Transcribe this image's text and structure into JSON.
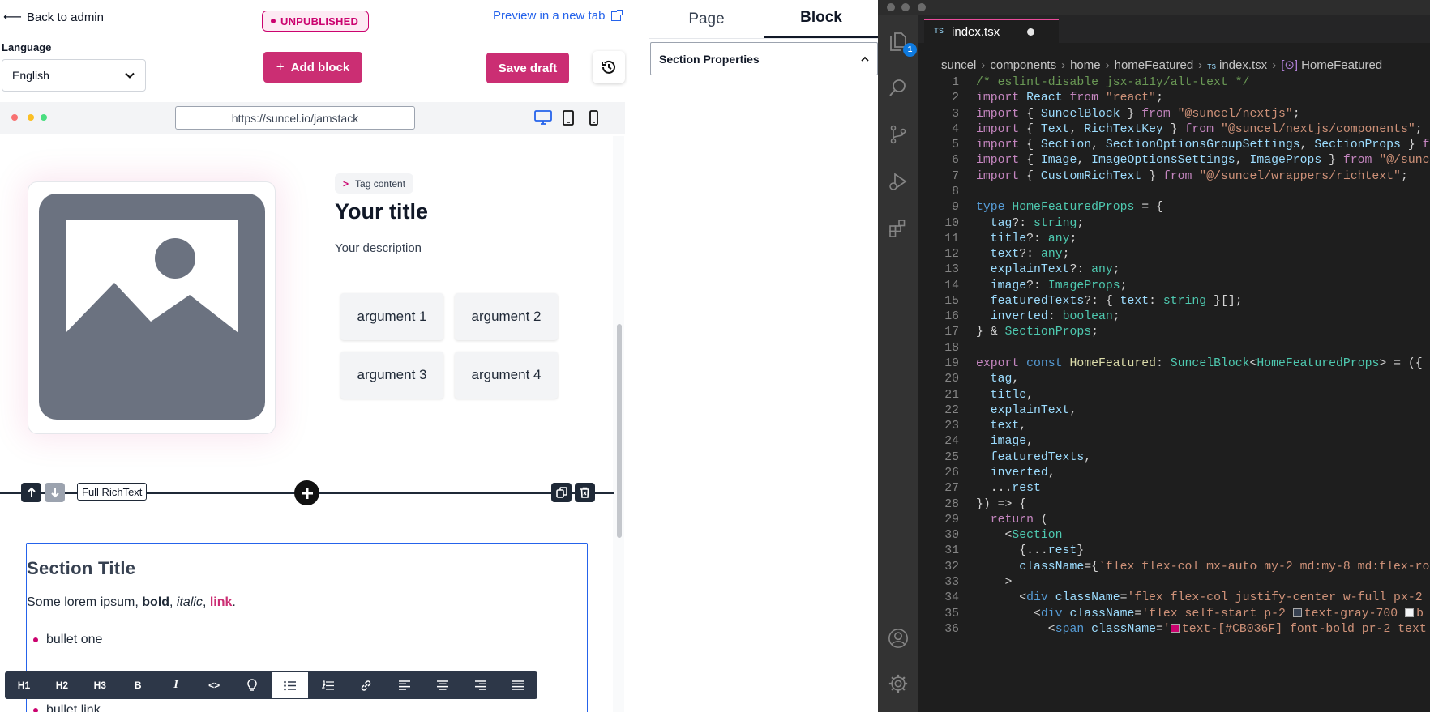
{
  "editor": {
    "back_label": "Back to admin",
    "status_badge": "UNPUBLISHED",
    "preview_label": "Preview in a new tab",
    "language_label": "Language",
    "language_value": "English",
    "add_block_label": "Add block",
    "save_draft_label": "Save draft",
    "url": "https://suncel.io/jamstack",
    "accent_color": "#cb2e73"
  },
  "featured": {
    "tag": "Tag content",
    "title": "Your title",
    "description": "Your description",
    "arguments": [
      "argument 1",
      "argument 2",
      "argument 3",
      "argument 4"
    ]
  },
  "block_bar": {
    "label": "Full RichText"
  },
  "richtext": {
    "title": "Section Title",
    "lorem_prefix": "Some lorem ipsum, ",
    "bold": "bold",
    "comma1": ", ",
    "italic": "italic",
    "comma2": ", ",
    "link": "link",
    "period": ".",
    "bullet_one": "bullet one",
    "bullet_partial": "bullet link"
  },
  "toolbar": {
    "buttons": [
      "H1",
      "H2",
      "H3",
      "B",
      "I",
      "<>"
    ]
  },
  "properties": {
    "tab_page": "Page",
    "tab_block": "Block",
    "section_properties": "Section Properties"
  },
  "vscode": {
    "tab_lang": "TS",
    "tab_file": "index.tsx",
    "badge_count": "1",
    "breadcrumb": [
      "suncel",
      "components",
      "home",
      "homeFeatured",
      "index.tsx",
      "HomeFeatured"
    ],
    "line_numbers": [
      "1",
      "2",
      "3",
      "4",
      "5",
      "6",
      "7",
      "8",
      "9",
      "10",
      "11",
      "12",
      "13",
      "14",
      "15",
      "16",
      "17",
      "18",
      "19",
      "20",
      "21",
      "22",
      "23",
      "24",
      "25",
      "26",
      "27",
      "28",
      "29",
      "30",
      "31",
      "32",
      "33",
      "34",
      "35",
      "36"
    ]
  }
}
